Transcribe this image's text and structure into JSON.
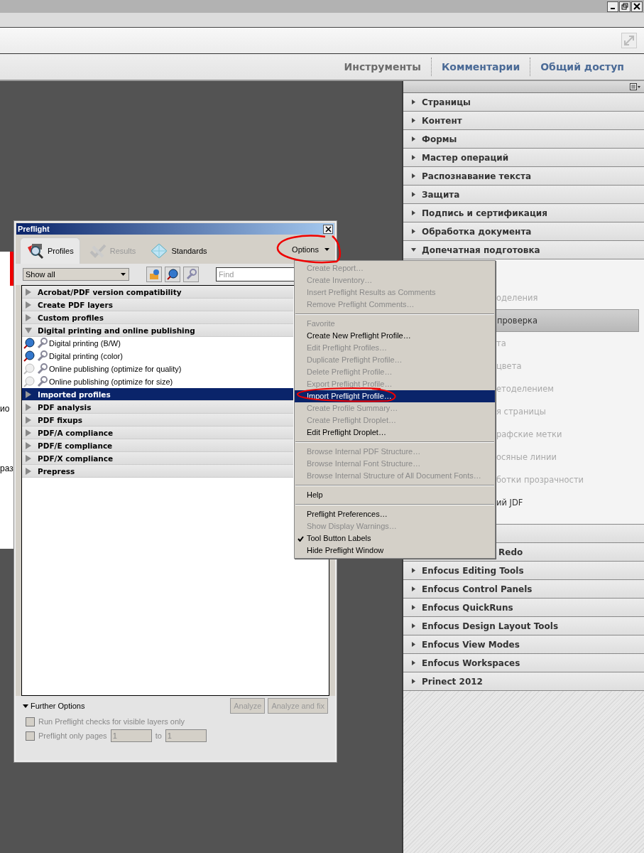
{
  "tabs": [
    {
      "label": "Инструменты",
      "selected": true
    },
    {
      "label": "Комментарии",
      "selected": false
    },
    {
      "label": "Общий доступ",
      "selected": false
    }
  ],
  "document_fragments": [
    "ио",
    "раз"
  ],
  "panel": {
    "sections": [
      {
        "label": "Страницы",
        "expanded": false
      },
      {
        "label": "Контент",
        "expanded": false
      },
      {
        "label": "Формы",
        "expanded": false
      },
      {
        "label": "Мастер операций",
        "expanded": false
      },
      {
        "label": "Распознавание текста",
        "expanded": false
      },
      {
        "label": "Защита",
        "expanded": false
      },
      {
        "label": "Подпись и сертификация",
        "expanded": false
      },
      {
        "label": "Обработка документа",
        "expanded": false
      },
      {
        "label": "Допечатная подготовка",
        "expanded": true,
        "children": [
          {
            "label": "оделения",
            "selected": false
          },
          {
            "label": "проверка",
            "selected": true
          },
          {
            "label": "та",
            "selected": false
          },
          {
            "label": "цвета",
            "selected": false
          },
          {
            "label": "етоделением",
            "selected": false
          },
          {
            "label": "я страницы",
            "selected": false
          },
          {
            "label": "рафские метки",
            "selected": false
          },
          {
            "label": "осяные линии",
            "selected": false
          },
          {
            "label": "ботки прозрачности",
            "selected": false
          },
          {
            "label": "ий JDF",
            "selected": false
          }
        ]
      },
      {
        "label": "Redo",
        "expanded": false,
        "partial": true
      },
      {
        "label": "Enfocus Editing Tools",
        "expanded": false
      },
      {
        "label": "Enfocus Control Panels",
        "expanded": false
      },
      {
        "label": "Enfocus QuickRuns",
        "expanded": false
      },
      {
        "label": "Enfocus Design Layout Tools",
        "expanded": false
      },
      {
        "label": "Enfocus View Modes",
        "expanded": false
      },
      {
        "label": "Enfocus Workspaces",
        "expanded": false
      },
      {
        "label": "Prinect 2012",
        "expanded": false
      }
    ]
  },
  "preflight": {
    "title": "Preflight",
    "tabs": [
      {
        "label": "Profiles",
        "selected": true,
        "disabled": false
      },
      {
        "label": "Results",
        "selected": false,
        "disabled": true
      },
      {
        "label": "Standards",
        "selected": false,
        "disabled": false
      }
    ],
    "options": "Options",
    "filter": "Show all",
    "find": {
      "placeholder": "Find"
    },
    "groups": [
      {
        "label": "Acrobat/PDF version compatibility",
        "expanded": false,
        "selected": false
      },
      {
        "label": "Create PDF layers",
        "expanded": false,
        "selected": false
      },
      {
        "label": "Custom profiles",
        "expanded": false,
        "selected": false
      },
      {
        "label": "Digital printing and online publishing",
        "expanded": true,
        "selected": false,
        "children": [
          {
            "label": "Digital printing (B/W)",
            "active": true
          },
          {
            "label": "Digital printing (color)",
            "active": true
          },
          {
            "label": "Online publishing (optimize for quality)",
            "active": false
          },
          {
            "label": "Online publishing (optimize for size)",
            "active": false
          }
        ]
      },
      {
        "label": "Imported profiles",
        "expanded": false,
        "selected": true
      },
      {
        "label": "PDF analysis",
        "expanded": false,
        "selected": false
      },
      {
        "label": "PDF fixups",
        "expanded": false,
        "selected": false
      },
      {
        "label": "PDF/A compliance",
        "expanded": false,
        "selected": false
      },
      {
        "label": "PDF/E compliance",
        "expanded": false,
        "selected": false
      },
      {
        "label": "PDF/X compliance",
        "expanded": false,
        "selected": false
      },
      {
        "label": "Prepress",
        "expanded": false,
        "selected": false
      }
    ],
    "further_options": {
      "label": "Further Options",
      "expanded": true
    },
    "buttons": [
      {
        "label": "Analyze",
        "disabled": true
      },
      {
        "label": "Analyze and fix",
        "disabled": true
      }
    ],
    "visible_layers": {
      "label": "Run Preflight checks for visible layers only",
      "checked": false
    },
    "pages": {
      "label": "Preflight only pages",
      "checked": false,
      "from": "1",
      "to_label": "to",
      "to": "1"
    }
  },
  "menu": [
    [
      {
        "label": "Create Report…",
        "disabled": true,
        "checked": false,
        "selected": false
      },
      {
        "label": "Create Inventory…",
        "disabled": true,
        "checked": false,
        "selected": false
      },
      {
        "label": "Insert Preflight Results as Comments",
        "disabled": true,
        "checked": false,
        "selected": false
      },
      {
        "label": "Remove Preflight Comments…",
        "disabled": true,
        "checked": false,
        "selected": false
      }
    ],
    [
      {
        "label": "Favorite",
        "disabled": true,
        "checked": false,
        "selected": false
      },
      {
        "label": "Create New Preflight Profile…",
        "disabled": false,
        "checked": false,
        "selected": false
      },
      {
        "label": "Edit Preflight Profiles…",
        "disabled": true,
        "checked": false,
        "selected": false
      },
      {
        "label": "Duplicate Preflight Profile…",
        "disabled": true,
        "checked": false,
        "selected": false
      },
      {
        "label": "Delete Preflight Profile…",
        "disabled": true,
        "checked": false,
        "selected": false
      },
      {
        "label": "Export Preflight Profile…",
        "disabled": true,
        "checked": false,
        "selected": false
      },
      {
        "label": "Import Preflight Profile…",
        "disabled": false,
        "checked": false,
        "selected": true
      },
      {
        "label": "Create Profile Summary…",
        "disabled": true,
        "checked": false,
        "selected": false
      },
      {
        "label": "Create Preflight Droplet…",
        "disabled": true,
        "checked": false,
        "selected": false
      },
      {
        "label": "Edit Preflight Droplet…",
        "disabled": false,
        "checked": false,
        "selected": false
      }
    ],
    [
      {
        "label": "Browse Internal PDF Structure…",
        "disabled": true,
        "checked": false,
        "selected": false
      },
      {
        "label": "Browse Internal Font Structure…",
        "disabled": true,
        "checked": false,
        "selected": false
      },
      {
        "label": "Browse Internal Structure of All Document Fonts…",
        "disabled": true,
        "checked": false,
        "selected": false
      }
    ],
    [
      {
        "label": "Help",
        "disabled": false,
        "checked": false,
        "selected": false
      }
    ],
    [
      {
        "label": "Preflight Preferences…",
        "disabled": false,
        "checked": false,
        "selected": false
      },
      {
        "label": "Show Display Warnings…",
        "disabled": true,
        "checked": false,
        "selected": false
      },
      {
        "label": "Tool Button Labels",
        "disabled": false,
        "checked": true,
        "selected": false
      },
      {
        "label": "Hide Preflight Window",
        "disabled": false,
        "checked": false,
        "selected": false
      }
    ]
  ]
}
